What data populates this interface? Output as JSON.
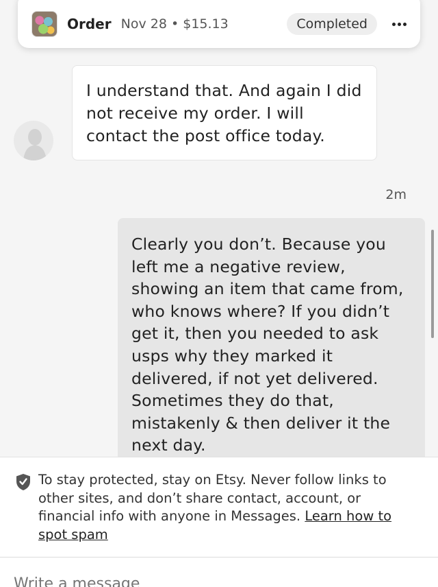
{
  "order": {
    "label": "Order",
    "date": "Nov 28",
    "separator": "•",
    "price": "$15.13",
    "status": "Completed",
    "more_icon": "more-horizontal-icon"
  },
  "messages": [
    {
      "direction": "incoming",
      "text": "I understand that. And again I did not receive my order. I will contact the post office today."
    },
    {
      "direction": "outgoing",
      "timestamp": "2m",
      "text": "Clearly you don’t. Because you left  me a negative review, showing an item that came from, who knows where? If you didn’t get it, then you needed to ask usps why they marked it delivered, if not yet delivered. Sometimes they do that, mistakenly & then deliver it the next day."
    }
  ],
  "notice": {
    "icon": "shield-check-icon",
    "text": "To stay protected, stay on Etsy. Never follow links to other sites, and don’t share contact, account, or financial info with anyone in Messages. ",
    "link": "Learn how to spot spam"
  },
  "composer": {
    "placeholder": "Write a message"
  },
  "colors": {
    "background": "#f5f5f5",
    "outgoing_bubble": "#e6e6e6",
    "incoming_bubble": "#ffffff",
    "status_pill": "#eeeeee"
  }
}
